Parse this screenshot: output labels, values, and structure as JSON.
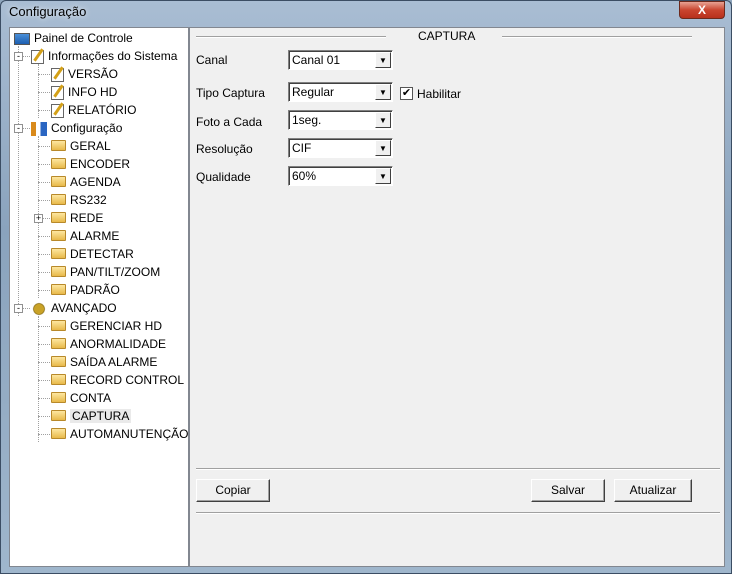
{
  "window": {
    "title": "Configuração",
    "close_label": "X"
  },
  "tree": [
    {
      "label": "Painel de Controle",
      "level": 0,
      "icon": "computer-icon"
    },
    {
      "label": "Informações do Sistema",
      "level": 1,
      "icon": "note-edit-icon",
      "expander": "-"
    },
    {
      "label": "VERSÃO",
      "level": 2,
      "icon": "note-edit-icon"
    },
    {
      "label": "INFO HD",
      "level": 2,
      "icon": "note-edit-icon"
    },
    {
      "label": "RELATÓRIO",
      "level": 2,
      "icon": "note-edit-icon"
    },
    {
      "label": "Configuração",
      "level": 1,
      "icon": "tools-icon",
      "expander": "-"
    },
    {
      "label": "GERAL",
      "level": 2,
      "icon": "folder-icon"
    },
    {
      "label": "ENCODER",
      "level": 2,
      "icon": "folder-icon"
    },
    {
      "label": "AGENDA",
      "level": 2,
      "icon": "folder-icon"
    },
    {
      "label": "RS232",
      "level": 2,
      "icon": "folder-icon"
    },
    {
      "label": "REDE",
      "level": 2,
      "icon": "folder-icon",
      "expander": "+"
    },
    {
      "label": "ALARME",
      "level": 2,
      "icon": "folder-icon"
    },
    {
      "label": "DETECTAR",
      "level": 2,
      "icon": "folder-icon"
    },
    {
      "label": "PAN/TILT/ZOOM",
      "level": 2,
      "icon": "folder-icon"
    },
    {
      "label": "PADRÃO",
      "level": 2,
      "icon": "folder-icon"
    },
    {
      "label": "AVANÇADO",
      "level": 1,
      "icon": "gears-icon",
      "expander": "-"
    },
    {
      "label": "GERENCIAR HD",
      "level": 2,
      "icon": "folder-icon"
    },
    {
      "label": "ANORMALIDADE",
      "level": 2,
      "icon": "folder-icon"
    },
    {
      "label": "SAÍDA ALARME",
      "level": 2,
      "icon": "folder-icon"
    },
    {
      "label": "RECORD CONTROL",
      "level": 2,
      "icon": "folder-icon"
    },
    {
      "label": "CONTA",
      "level": 2,
      "icon": "folder-icon"
    },
    {
      "label": "CAPTURA",
      "level": 2,
      "icon": "folder-open-icon",
      "selected": true
    },
    {
      "label": "AUTOMANUTENÇÃO",
      "level": 2,
      "icon": "folder-icon"
    }
  ],
  "panel": {
    "section_title": "CAPTURA",
    "fields": [
      {
        "label": "Canal",
        "value": "Canal 01"
      },
      {
        "label": "Tipo Captura",
        "value": "Regular"
      },
      {
        "label": "Foto a Cada",
        "value": "1seg."
      },
      {
        "label": "Resolução",
        "value": "CIF"
      },
      {
        "label": "Qualidade",
        "value": "60%"
      }
    ],
    "enable": {
      "label": "Habilitar",
      "checked": true,
      "mark": "✔"
    },
    "buttons": {
      "copy": "Copiar",
      "save": "Salvar",
      "refresh": "Atualizar"
    }
  }
}
